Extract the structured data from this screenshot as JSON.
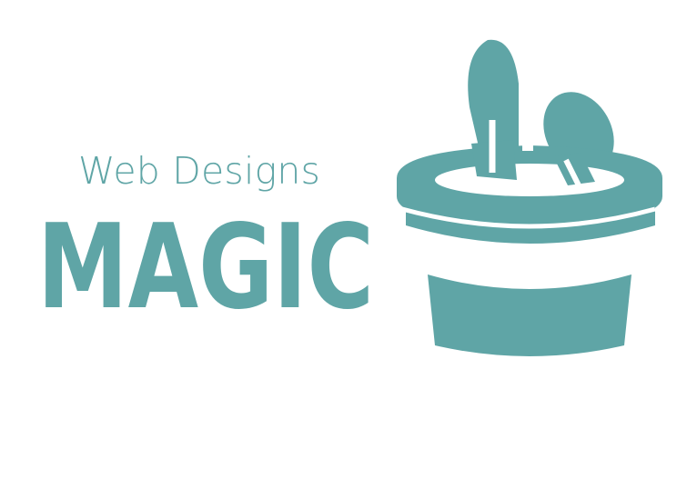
{
  "brand": {
    "tagline": "Web Designs",
    "wordmark": "MAGIC",
    "color": "#5fa5a6",
    "icon": "magic-hat-with-rabbit-icon"
  }
}
